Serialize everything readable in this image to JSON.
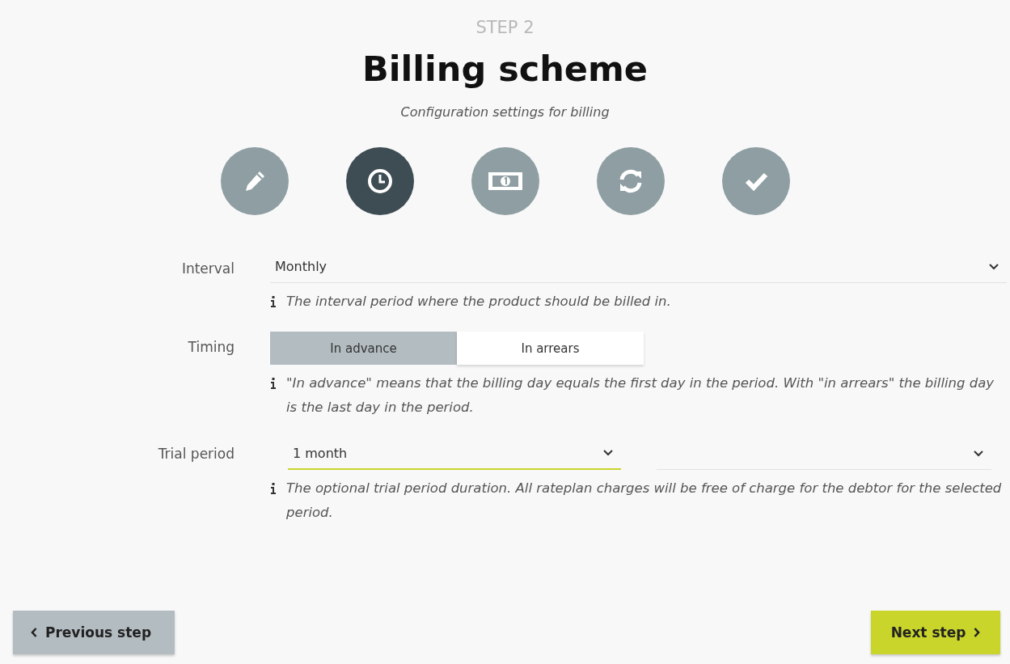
{
  "step_label": "STEP 2",
  "title": "Billing scheme",
  "subtitle": "Configuration settings for billing",
  "steps": [
    {
      "kind": "pencil",
      "selected": false
    },
    {
      "kind": "clock",
      "selected": true
    },
    {
      "kind": "money",
      "selected": false
    },
    {
      "kind": "refresh",
      "selected": false
    },
    {
      "kind": "check",
      "selected": false
    }
  ],
  "interval": {
    "label": "Interval",
    "value": "Monthly",
    "hint": "The interval period where the product should be billed in."
  },
  "timing": {
    "label": "Timing",
    "options": [
      {
        "label": "In advance",
        "selected": true
      },
      {
        "label": "In arrears",
        "selected": false
      }
    ],
    "hint": "\"In advance\" means that the billing day equals the first day in the period. With \"in arrears\" the billing day is the last day in the period."
  },
  "trial_period": {
    "label": "Trial period",
    "amount": {
      "value": "1 month",
      "focused": true
    },
    "unit": {
      "focused": false
    },
    "hint": "The optional trial period duration. All rateplan charges will be free of charge for the debtor for the selected period."
  },
  "buttons": {
    "previous": "Previous step",
    "next": "Next step"
  }
}
